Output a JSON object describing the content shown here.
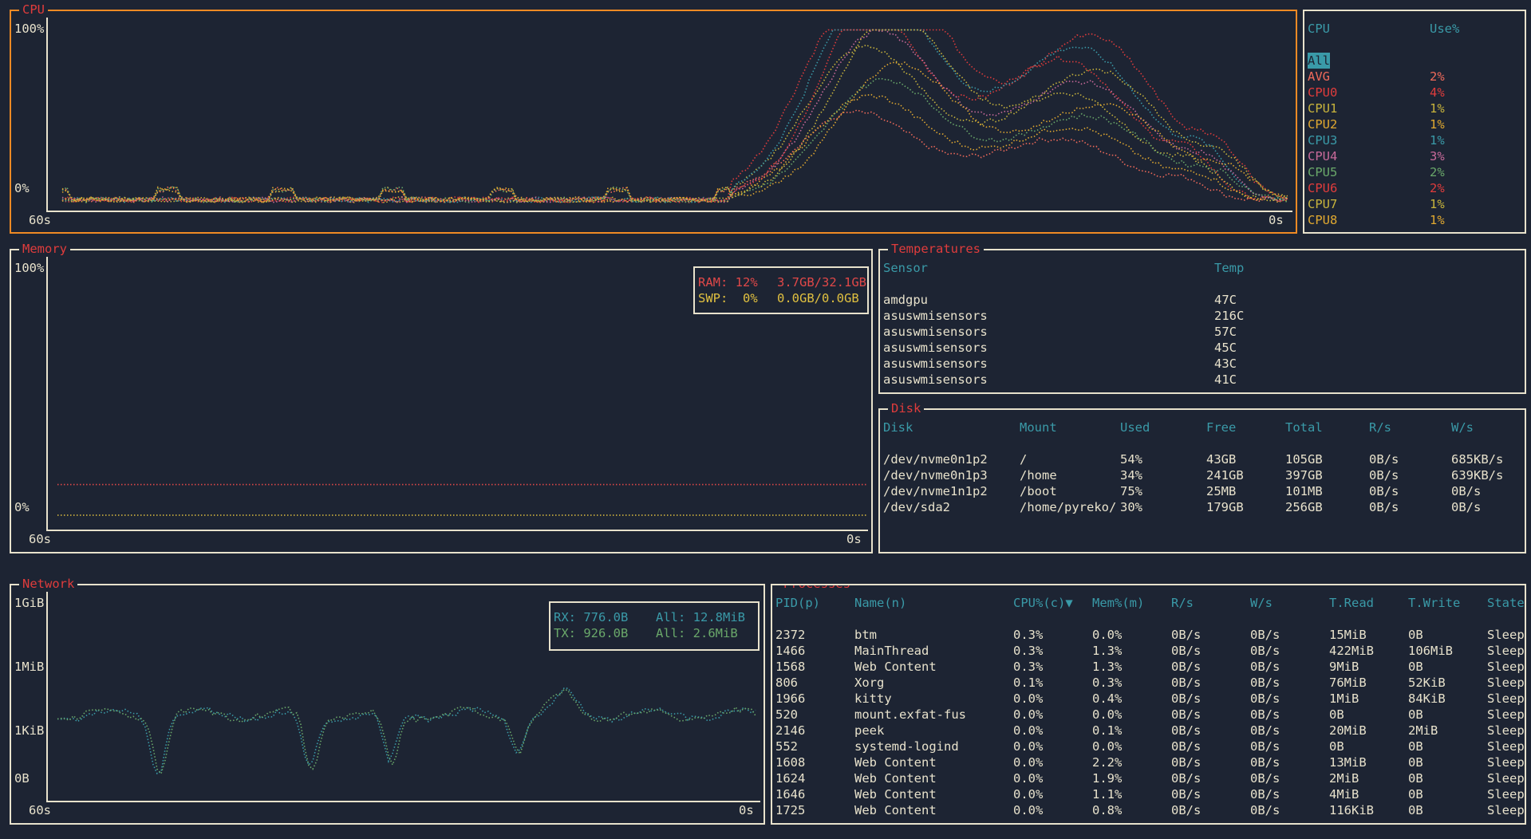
{
  "colors": {
    "bg": "#1d2433",
    "fg": "#e8e2cc",
    "header": "#3a9aa8",
    "title": "#e03c3c",
    "cpu_border": "#f08a24"
  },
  "cpu": {
    "title": "CPU",
    "y_max": "100%",
    "y_min": "0%",
    "x_start": "60s",
    "x_end": "0s",
    "legend_header_cpu": "CPU",
    "legend_header_use": "Use%",
    "all_label": "All",
    "rows": [
      {
        "name": "AVG",
        "use": "2%",
        "color": "#f06a5a"
      },
      {
        "name": "CPU0",
        "use": "4%",
        "color": "#e03c3c"
      },
      {
        "name": "CPU1",
        "use": "1%",
        "color": "#c8b43c"
      },
      {
        "name": "CPU2",
        "use": "1%",
        "color": "#e0a830"
      },
      {
        "name": "CPU3",
        "use": "1%",
        "color": "#3a9aa8"
      },
      {
        "name": "CPU4",
        "use": "3%",
        "color": "#c86a9a"
      },
      {
        "name": "CPU5",
        "use": "2%",
        "color": "#6aa86a"
      },
      {
        "name": "CPU6",
        "use": "2%",
        "color": "#e03c3c"
      },
      {
        "name": "CPU7",
        "use": "1%",
        "color": "#c8b43c"
      },
      {
        "name": "CPU8",
        "use": "1%",
        "color": "#e0a830"
      }
    ]
  },
  "memory": {
    "title": "Memory",
    "y_max": "100%",
    "y_min": "0%",
    "x_start": "60s",
    "x_end": "0s",
    "ram_label": "RAM: 12%",
    "ram_value": "3.7GB/32.1GB",
    "swp_label": "SWP:  0%",
    "swp_value": "0.0GB/0.0GB",
    "ram_color": "#e04848",
    "swp_color": "#e0c040",
    "ram_pct": 12,
    "swp_pct": 0
  },
  "temperatures": {
    "title": "Temperatures",
    "col_sensor": "Sensor",
    "col_temp": "Temp",
    "rows": [
      {
        "sensor": "amdgpu",
        "temp": "47C"
      },
      {
        "sensor": "asuswmisensors",
        "temp": "216C"
      },
      {
        "sensor": "asuswmisensors",
        "temp": "57C"
      },
      {
        "sensor": "asuswmisensors",
        "temp": "45C"
      },
      {
        "sensor": "asuswmisensors",
        "temp": "43C"
      },
      {
        "sensor": "asuswmisensors",
        "temp": "41C"
      }
    ]
  },
  "disk": {
    "title": "Disk",
    "columns": [
      "Disk",
      "Mount",
      "Used",
      "Free",
      "Total",
      "R/s",
      "W/s"
    ],
    "rows": [
      [
        "/dev/nvme0n1p2",
        "/",
        "54%",
        "43GB",
        "105GB",
        "0B/s",
        "685KB/s"
      ],
      [
        "/dev/nvme0n1p3",
        "/home",
        "34%",
        "241GB",
        "397GB",
        "0B/s",
        "639KB/s"
      ],
      [
        "/dev/nvme1n1p2",
        "/boot",
        "75%",
        "25MB",
        "101MB",
        "0B/s",
        "0B/s"
      ],
      [
        "/dev/sda2",
        "/home/pyreko/",
        "30%",
        "179GB",
        "256GB",
        "0B/s",
        "0B/s"
      ]
    ]
  },
  "network": {
    "title": "Network",
    "y_labels": [
      "1GiB",
      "1MiB",
      "1KiB",
      "0B"
    ],
    "x_start": "60s",
    "x_end": "0s",
    "rx_label": "RX: 776.0B",
    "rx_all": "All: 12.8MiB",
    "tx_label": "TX: 926.0B",
    "tx_all": "All: 2.6MiB",
    "rx_color": "#3a9aa8",
    "tx_color": "#6aa86a"
  },
  "processes": {
    "title": "Processes",
    "columns": [
      "PID(p)",
      "Name(n)",
      "CPU%(c)▼",
      "Mem%(m)",
      "R/s",
      "W/s",
      "T.Read",
      "T.Write",
      "State"
    ],
    "rows": [
      [
        "2372",
        "btm",
        "0.3%",
        "0.0%",
        "0B/s",
        "0B/s",
        "15MiB",
        "0B",
        "Sleep"
      ],
      [
        "1466",
        "MainThread",
        "0.3%",
        "1.3%",
        "0B/s",
        "0B/s",
        "422MiB",
        "106MiB",
        "Sleep"
      ],
      [
        "1568",
        "Web Content",
        "0.3%",
        "1.3%",
        "0B/s",
        "0B/s",
        "9MiB",
        "0B",
        "Sleep"
      ],
      [
        "806",
        "Xorg",
        "0.1%",
        "0.3%",
        "0B/s",
        "0B/s",
        "76MiB",
        "52KiB",
        "Sleep"
      ],
      [
        "1966",
        "kitty",
        "0.0%",
        "0.4%",
        "0B/s",
        "0B/s",
        "1MiB",
        "84KiB",
        "Sleep"
      ],
      [
        "520",
        "mount.exfat-fus",
        "0.0%",
        "0.0%",
        "0B/s",
        "0B/s",
        "0B",
        "0B",
        "Sleep"
      ],
      [
        "2146",
        "peek",
        "0.0%",
        "0.1%",
        "0B/s",
        "0B/s",
        "20MiB",
        "2MiB",
        "Sleep"
      ],
      [
        "552",
        "systemd-logind",
        "0.0%",
        "0.0%",
        "0B/s",
        "0B/s",
        "0B",
        "0B",
        "Sleep"
      ],
      [
        "1608",
        "Web Content",
        "0.0%",
        "2.2%",
        "0B/s",
        "0B/s",
        "13MiB",
        "0B",
        "Sleep"
      ],
      [
        "1624",
        "Web Content",
        "0.0%",
        "1.9%",
        "0B/s",
        "0B/s",
        "2MiB",
        "0B",
        "Sleep"
      ],
      [
        "1646",
        "Web Content",
        "0.0%",
        "1.1%",
        "0B/s",
        "0B/s",
        "4MiB",
        "0B",
        "Sleep"
      ],
      [
        "1725",
        "Web Content",
        "0.0%",
        "0.8%",
        "0B/s",
        "0B/s",
        "116KiB",
        "0B",
        "Sleep"
      ]
    ]
  }
}
